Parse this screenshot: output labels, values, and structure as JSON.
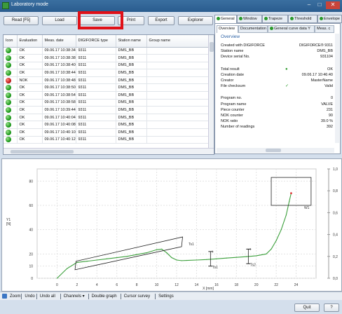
{
  "window": {
    "title": "Laboratory mode",
    "minimize": "–",
    "maximize": "□",
    "close": "✕"
  },
  "toolbar": {
    "read": "Read [F5]",
    "load": "Load",
    "save": "Save",
    "print": "Print",
    "export": "Export",
    "explorer": "Explorer"
  },
  "grid": {
    "headers": [
      "Icon",
      "Evaluation",
      "Meas. date",
      "DIGIFORCE type",
      "Station name",
      "Group name"
    ],
    "rows": [
      {
        "status": "ok",
        "evaluation": "OK",
        "date": "09.06.17 10:38:34.0...",
        "type": "9311",
        "station": "DMS_BB"
      },
      {
        "status": "ok",
        "evaluation": "OK",
        "date": "09.06.17 10:38:38.0...",
        "type": "9311",
        "station": "DMS_BB"
      },
      {
        "status": "ok",
        "evaluation": "OK",
        "date": "09.06.17 10:38:40.0...",
        "type": "9311",
        "station": "DMS_BB"
      },
      {
        "status": "ok",
        "evaluation": "OK",
        "date": "09.06.17 10:38:44.0...",
        "type": "9311",
        "station": "DMS_BB"
      },
      {
        "status": "nok",
        "evaluation": "NOK",
        "date": "09.06.17 10:38:48.0...",
        "type": "9311",
        "station": "DMS_BB"
      },
      {
        "status": "ok",
        "evaluation": "OK",
        "date": "09.06.17 10:38:50.0...",
        "type": "9311",
        "station": "DMS_BB"
      },
      {
        "status": "ok",
        "evaluation": "OK",
        "date": "09.06.17 10:38:54.0...",
        "type": "9311",
        "station": "DMS_BB"
      },
      {
        "status": "ok",
        "evaluation": "OK",
        "date": "09.06.17 10:38:58.0...",
        "type": "9311",
        "station": "DMS_BB"
      },
      {
        "status": "ok",
        "evaluation": "OK",
        "date": "09.06.17 10:39:44.0...",
        "type": "9311",
        "station": "DMS_BB"
      },
      {
        "status": "ok",
        "evaluation": "OK",
        "date": "09.06.17 10:40:04.0...",
        "type": "9311",
        "station": "DMS_BB"
      },
      {
        "status": "ok",
        "evaluation": "OK",
        "date": "09.06.17 10:40:08.0...",
        "type": "9311",
        "station": "DMS_BB"
      },
      {
        "status": "ok",
        "evaluation": "OK",
        "date": "09.06.17 10:40:10.0...",
        "type": "9311",
        "station": "DMS_BB"
      },
      {
        "status": "ok",
        "evaluation": "OK",
        "date": "09.06.17 10:40:12.0...",
        "type": "9311",
        "station": "DMS_BB"
      }
    ]
  },
  "right_tabs": [
    "General",
    "Window",
    "Trapeze",
    "Threshold",
    "Envelope"
  ],
  "right_subtabs": [
    "Overview",
    "Documentation",
    "General curve data Y",
    "Meas. c"
  ],
  "overview": {
    "heading": "Overview",
    "props": [
      {
        "label": "Created with DIGIFORCE",
        "value": "DIGIFORCE® 9311"
      },
      {
        "label": "Station name",
        "value": "DMS_BB"
      },
      {
        "label": "Device serial No.",
        "value": "931104"
      },
      {
        "label": "Total result",
        "value": "OK",
        "mark": "●"
      },
      {
        "label": "Creation date",
        "value": "09.06.17 10:46:40"
      },
      {
        "label": "Creator",
        "value": "MasterName"
      },
      {
        "label": "File checksum",
        "value": "Valid",
        "mark": "✓"
      },
      {
        "label": "Program no.",
        "value": "0"
      },
      {
        "label": "Program name",
        "value": "VALVE"
      },
      {
        "label": "Piece counter",
        "value": "231"
      },
      {
        "label": "NOK counter",
        "value": "90"
      },
      {
        "label": "NOK ratio",
        "value": "39.0 %"
      },
      {
        "label": "Number of readings",
        "value": "392"
      }
    ]
  },
  "chart_data": {
    "type": "line",
    "ylabel": "Y1\n[N]",
    "xlabel": "X [mm]",
    "y_ticks": [
      "80",
      "60",
      "40",
      "20",
      "10",
      "0"
    ],
    "y2_ticks": [
      "1,0",
      "0,8",
      "0,6",
      "0,4",
      "0,2",
      "0,0"
    ],
    "x_ticks": [
      "0",
      "2",
      "4",
      "6",
      "8",
      "10",
      "12",
      "14",
      "16",
      "18",
      "20",
      "22",
      "24"
    ],
    "grid": true,
    "annotations": [
      "Ts1",
      "Ts1",
      "Ts2",
      "W1"
    ],
    "series": [
      {
        "color": "#3ca03c",
        "x": [
          0,
          1,
          2,
          3,
          4,
          5,
          6,
          7,
          8,
          9,
          10,
          10.5,
          11,
          11.5,
          12,
          12.5,
          13,
          14,
          15,
          16,
          17,
          18,
          19,
          20,
          21,
          21.5,
          22,
          22.5,
          23,
          23.3,
          23.5
        ],
        "y": [
          0,
          8,
          13,
          14,
          15,
          16,
          17,
          18,
          19.5,
          21,
          23.5,
          24,
          21,
          17,
          15,
          14.5,
          14.7,
          15,
          15.4,
          16,
          16.6,
          17.2,
          17.8,
          18.5,
          20,
          24,
          31,
          40,
          52,
          63,
          70
        ]
      }
    ]
  },
  "chart_toolbar": [
    "Zoom",
    "Undo",
    "Undo all",
    "Channels ▾",
    "Double graph",
    "Cursor survey",
    "Settings"
  ],
  "footer": {
    "quit": "Quit",
    "help": "?"
  }
}
